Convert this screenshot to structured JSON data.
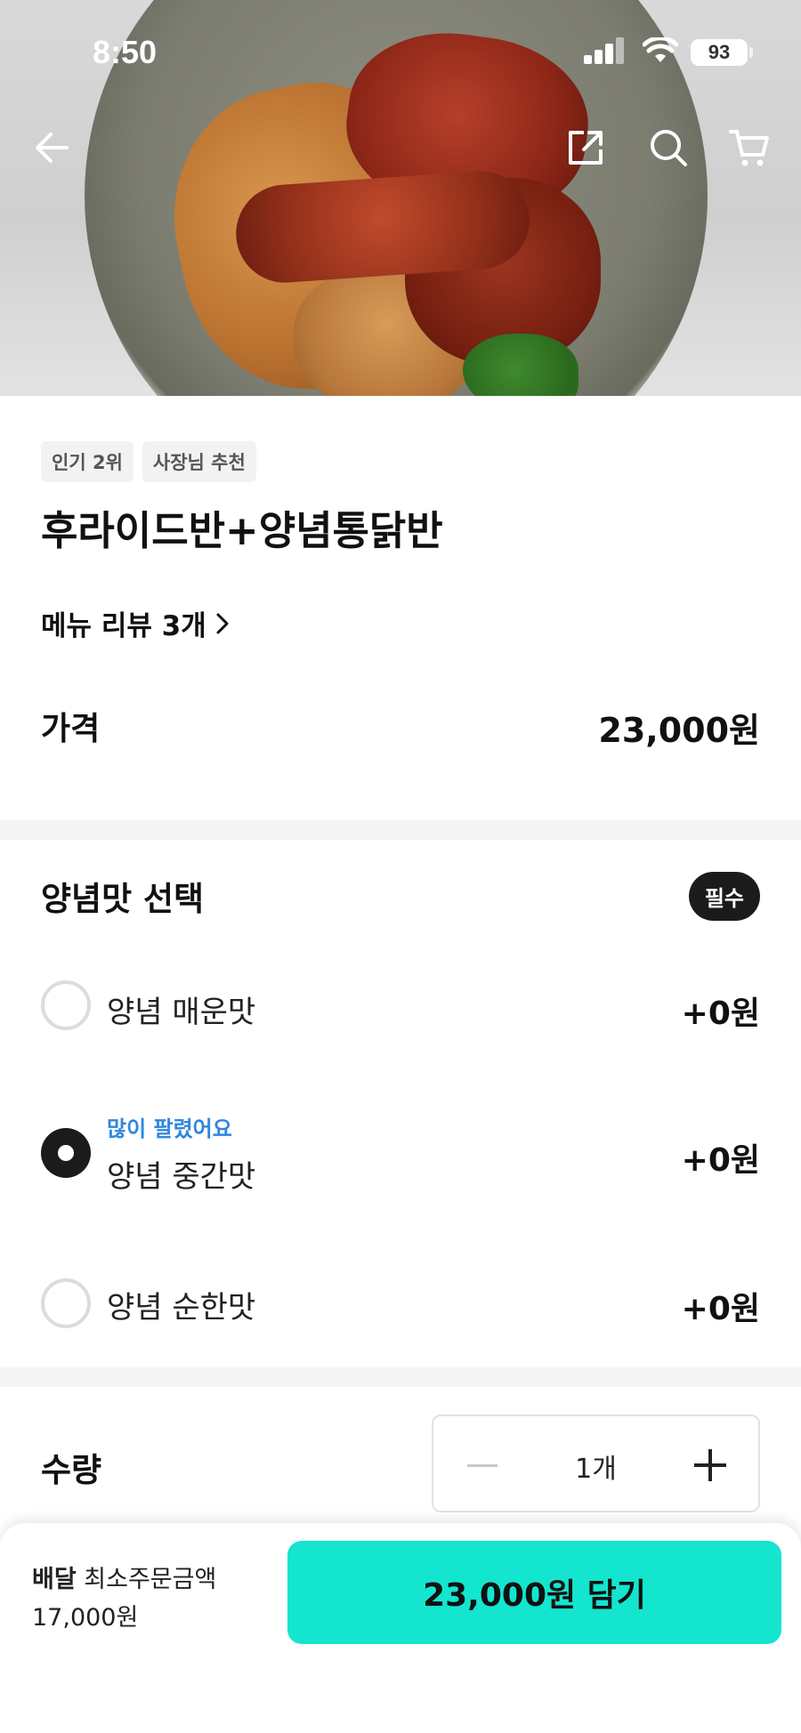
{
  "status_bar": {
    "time": "8:50",
    "battery": "93"
  },
  "header": {
    "icons": [
      "back-arrow-icon",
      "share-icon",
      "search-icon",
      "cart-icon"
    ]
  },
  "menu": {
    "tags": [
      "인기 2위",
      "사장님 추천"
    ],
    "title": "후라이드반+양념통닭반",
    "review_link": "메뉴 리뷰 3개",
    "price_label": "가격",
    "price_value": "23,000원"
  },
  "sauce_section": {
    "title": "양념맛 선택",
    "required_badge": "필수",
    "options": [
      {
        "label": "양념 매운맛",
        "price": "+0원",
        "selected": false,
        "badge": ""
      },
      {
        "label": "양념 중간맛",
        "price": "+0원",
        "selected": true,
        "badge": "많이 팔렸어요"
      },
      {
        "label": "양념 순한맛",
        "price": "+0원",
        "selected": false,
        "badge": ""
      }
    ]
  },
  "quantity": {
    "label": "수량",
    "value": "1개"
  },
  "bottom_bar": {
    "delivery_label": "배달",
    "min_order_label": "최소주문금액",
    "min_order_value": "17,000원",
    "cta_label": "23,000원 담기",
    "cta_color": "#13e5cf"
  }
}
